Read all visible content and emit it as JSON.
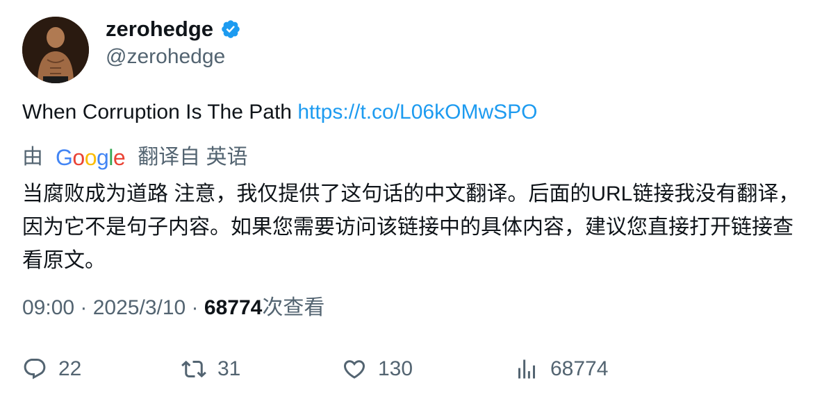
{
  "author": {
    "display_name": "zerohedge",
    "handle": "@zerohedge",
    "verified": true,
    "verified_color": "#1d9bf0"
  },
  "tweet": {
    "text": "When Corruption Is The Path ",
    "link_text": "https://t.co/L06kOMwSPO",
    "link_color": "#1d9bf0"
  },
  "translation": {
    "by_label": "由",
    "provider": "Google",
    "from_label": "翻译自 英语",
    "text": "当腐败成为道路 注意，我仅提供了这句话的中文翻译。后面的URL链接我没有翻译，因为它不是句子内容。如果您需要访问该链接中的具体内容，建议您直接打开链接查看原文。"
  },
  "meta": {
    "time": "09:00",
    "separator": " · ",
    "date": "2025/3/10",
    "views_count": "68774",
    "views_label": "次查看"
  },
  "actions": {
    "reply_count": "22",
    "retweet_count": "31",
    "like_count": "130",
    "views_count": "68774"
  },
  "icons": {
    "reply": "reply-icon",
    "retweet": "retweet-icon",
    "like": "heart-icon",
    "views": "analytics-icon",
    "verified": "verified-badge-icon"
  }
}
